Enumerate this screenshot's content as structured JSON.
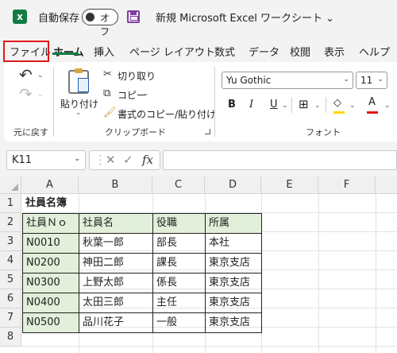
{
  "titlebar": {
    "app_icon": "excel-icon",
    "autosave_label": "自動保存",
    "autosave_state": "オフ",
    "document_title": "新規 Microsoft Excel ワークシート ⌄"
  },
  "tabs": [
    "ファイル",
    "ホーム",
    "挿入",
    "ページ レイアウト",
    "数式",
    "データ",
    "校閲",
    "表示",
    "ヘルプ"
  ],
  "active_tab": "ホーム",
  "highlighted_tab": "ファイル",
  "ribbon": {
    "undo_group_label": "元に戻す",
    "paste_label": "貼り付け",
    "cut_label": "切り取り",
    "copy_label": "コピー",
    "format_painter_label": "書式のコピー/貼り付け",
    "clipboard_group_label": "クリップボード",
    "font_name": "Yu Gothic",
    "font_size": "11",
    "bold_label": "B",
    "italic_label": "I",
    "underline_label": "U",
    "font_color_label": "A",
    "font_group_label": "フォント"
  },
  "formula_bar": {
    "name_box": "K11",
    "fx": "fx",
    "formula": ""
  },
  "sheet": {
    "columns": [
      "A",
      "B",
      "C",
      "D",
      "E",
      "F"
    ],
    "rows": [
      "1",
      "2",
      "3",
      "4",
      "5",
      "6",
      "7",
      "8"
    ],
    "title": "社員名簿",
    "headers": [
      "社員Ｎｏ",
      "社員名",
      "役職",
      "所属"
    ],
    "records": [
      [
        "N0010",
        "秋葉一郎",
        "部長",
        "本社"
      ],
      [
        "N0200",
        "神田二郎",
        "課長",
        "東京支店"
      ],
      [
        "N0300",
        "上野太郎",
        "係長",
        "東京支店"
      ],
      [
        "N0400",
        "太田三郎",
        "主任",
        "東京支店"
      ],
      [
        "N0500",
        "品川花子",
        "一般",
        "東京支店"
      ]
    ]
  },
  "colors": {
    "excel_green": "#107c41",
    "highlight_red": "#e01919",
    "header_fill": "#e2efda"
  }
}
